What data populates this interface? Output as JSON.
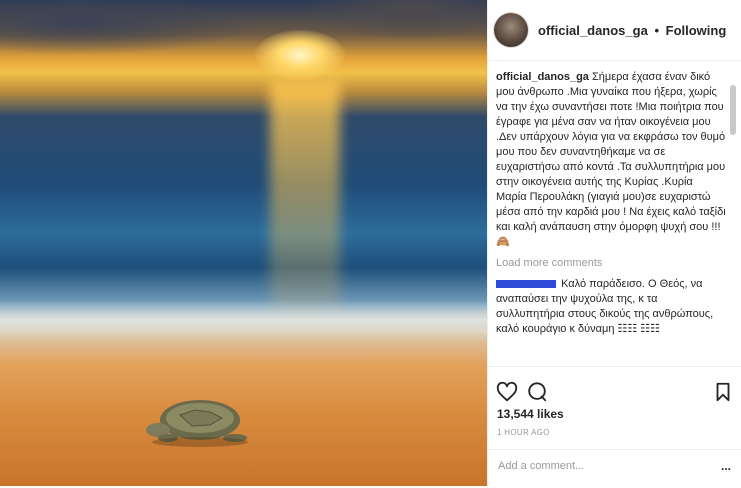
{
  "post": {
    "username": "official_danos_ga",
    "separator": "•",
    "follow_status": "Following",
    "caption": "Σήμερα έχασα έναν δικό μου άνθρωπο .Μια γυναίκα που ήξερα, χωρίς να την έχω συναντήσει ποτε !Μια ποιήτρια που έγραφε για μένα σαν να ήταν οικογένεια μου .Δεν υπάρχουν λόγια για να εκφράσω τον θυμό μου που δεν συναντηθήκαμε να σε ευχαριστήσω από κοντά .Τα συλλυπητήρια μου στην οικογένεια αυτής της Κυρίας .Κυρία Μαρία Περουλάκη (γιαγιά μου)σε ευχαριστώ μέσα από την καρδιά μου ! Να έχεις καλό ταξίδι και καλή ανάπαυση στην όμορφη ψυχή σου !!! 🙈",
    "load_more": "Load more comments",
    "comments": [
      {
        "text": "Καλό παράδεισο. Ο Θεός, να αναπαύσει την ψυχούλα της, κ τα συλλυπητήρια στους δικούς της ανθρώπους, καλό κουράγιο κ δύναμη ☷☷ ☷☷"
      }
    ],
    "likes": "13,544 likes",
    "time": "1 HOUR AGO",
    "add_comment_placeholder": "Add a comment...",
    "more_options": "..."
  },
  "icons": {
    "like": "heart-icon",
    "comment": "comment-icon",
    "save": "bookmark-icon"
  },
  "colors": {
    "text": "#262626",
    "muted": "#999999",
    "border": "#efefef",
    "redaction": "#2d4bd8"
  }
}
